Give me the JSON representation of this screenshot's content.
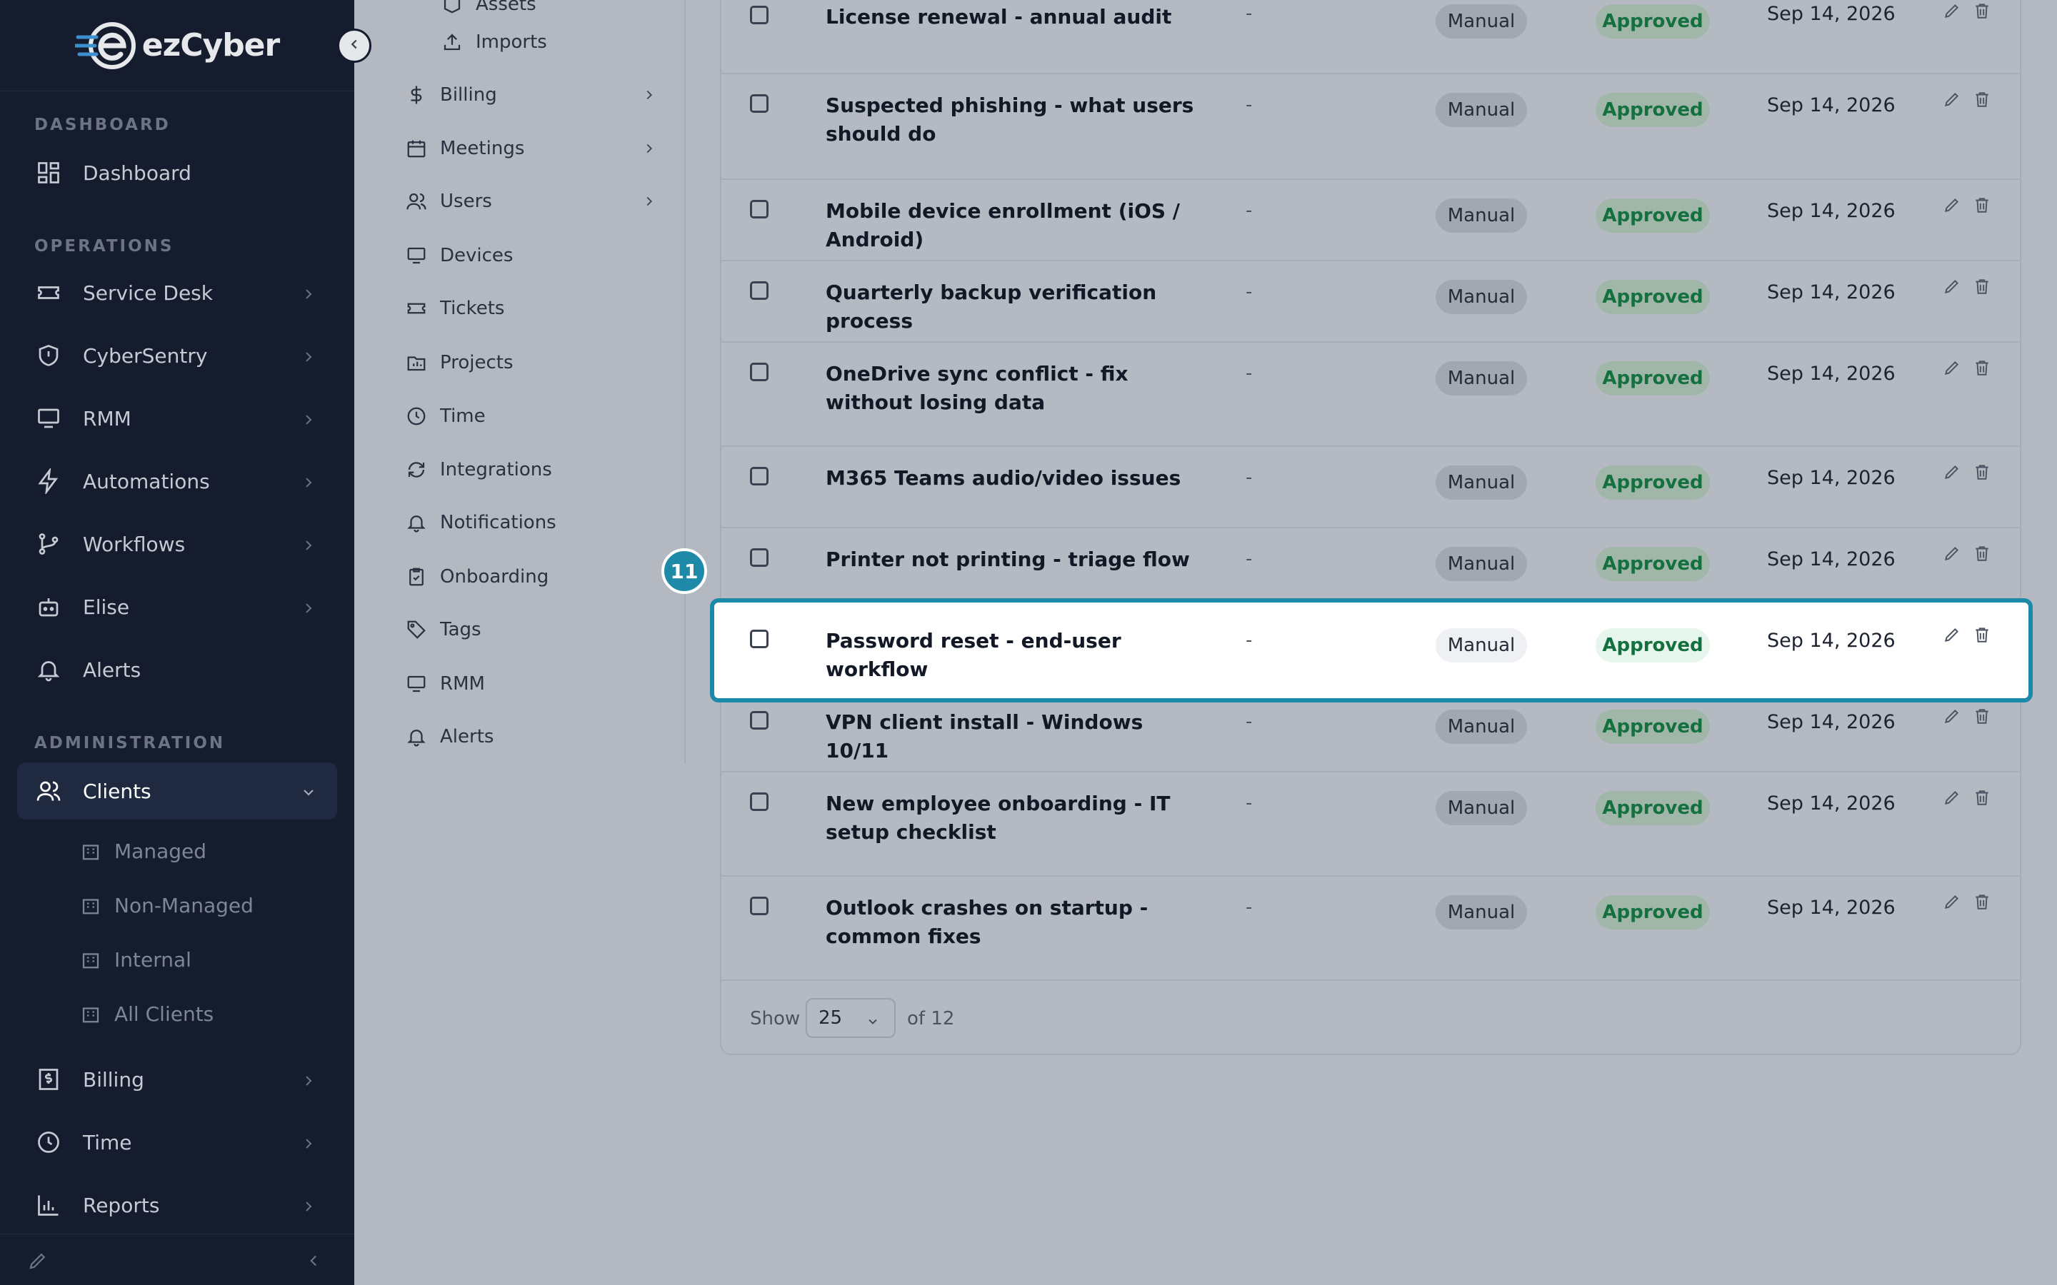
{
  "brand": {
    "name": "ezCyber"
  },
  "sidebar": {
    "sections": {
      "dashboard": "DASHBOARD",
      "operations": "OPERATIONS",
      "administration": "ADMINISTRATION"
    },
    "items": {
      "dashboard": "Dashboard",
      "service_desk": "Service Desk",
      "cybersentry": "CyberSentry",
      "rmm": "RMM",
      "automations": "Automations",
      "workflows": "Workflows",
      "elise": "Elise",
      "alerts": "Alerts",
      "clients": "Clients",
      "billing": "Billing",
      "time": "Time",
      "reports": "Reports"
    },
    "clients_sub": [
      "Managed",
      "Non-Managed",
      "Internal",
      "All Clients"
    ]
  },
  "client_menu": {
    "assets": "Assets",
    "imports": "Imports",
    "billing": "Billing",
    "meetings": "Meetings",
    "users": "Users",
    "devices": "Devices",
    "tickets": "Tickets",
    "projects": "Projects",
    "time": "Time",
    "integrations": "Integrations",
    "notifications": "Notifications",
    "onboarding": "Onboarding",
    "tags": "Tags",
    "rmm": "RMM",
    "alerts": "Alerts"
  },
  "table": {
    "rows": [
      {
        "title": "License renewal - annual audit",
        "dash": "-",
        "source": "Manual",
        "status": "Approved",
        "date": "Sep 14, 2026"
      },
      {
        "title": "Suspected phishing - what users should do",
        "dash": "-",
        "source": "Manual",
        "status": "Approved",
        "date": "Sep 14, 2026"
      },
      {
        "title": "Mobile device enrollment (iOS / Android)",
        "dash": "-",
        "source": "Manual",
        "status": "Approved",
        "date": "Sep 14, 2026"
      },
      {
        "title": "Quarterly backup verification process",
        "dash": "-",
        "source": "Manual",
        "status": "Approved",
        "date": "Sep 14, 2026"
      },
      {
        "title": "OneDrive sync conflict - fix without losing data",
        "dash": "-",
        "source": "Manual",
        "status": "Approved",
        "date": "Sep 14, 2026"
      },
      {
        "title": "M365 Teams audio/video issues",
        "dash": "-",
        "source": "Manual",
        "status": "Approved",
        "date": "Sep 14, 2026"
      },
      {
        "title": "Printer not printing - triage flow",
        "dash": "-",
        "source": "Manual",
        "status": "Approved",
        "date": "Sep 14, 2026"
      },
      {
        "title": "Password reset - end-user workflow",
        "dash": "-",
        "source": "Manual",
        "status": "Approved",
        "date": "Sep 14, 2026"
      },
      {
        "title": "VPN client install - Windows 10/11",
        "dash": "-",
        "source": "Manual",
        "status": "Approved",
        "date": "Sep 14, 2026"
      },
      {
        "title": "New employee onboarding - IT setup checklist",
        "dash": "-",
        "source": "Manual",
        "status": "Approved",
        "date": "Sep 14, 2026"
      },
      {
        "title": "Outlook crashes on startup - common fixes",
        "dash": "-",
        "source": "Manual",
        "status": "Approved",
        "date": "Sep 14, 2026"
      }
    ]
  },
  "pagination": {
    "show_label": "Show",
    "page_size": "25",
    "total": "of 12"
  },
  "step_badge": "11",
  "colors": {
    "highlight": "#1b8aa8",
    "approved_text": "#14703f",
    "sidebar_bg": "#151c2d"
  }
}
